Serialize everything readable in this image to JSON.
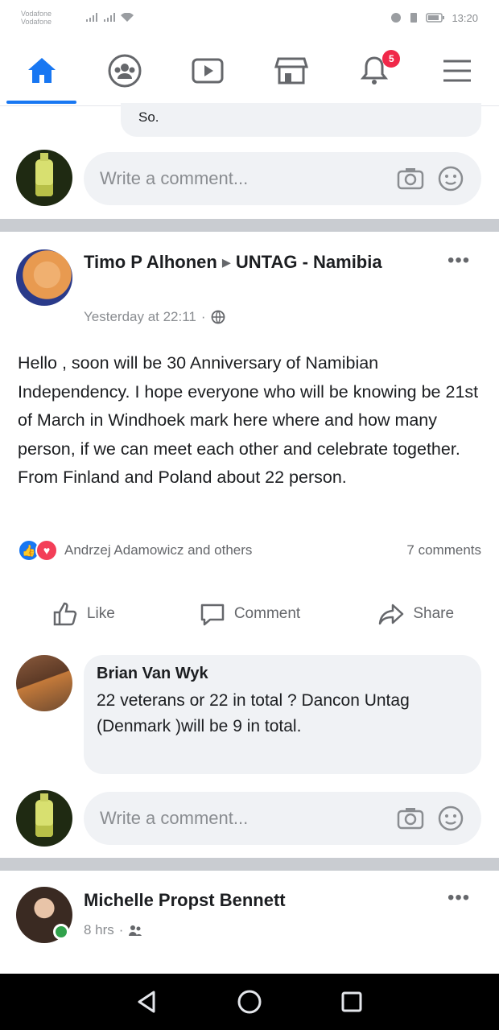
{
  "status_bar": {
    "carrier_line1": "Vodafone",
    "carrier_line2": "Vodafone",
    "time": "13:20"
  },
  "nav": {
    "tabs": [
      {
        "name": "home",
        "icon": "home-icon",
        "active": true
      },
      {
        "name": "groups",
        "icon": "groups-icon",
        "active": false
      },
      {
        "name": "watch",
        "icon": "watch-icon",
        "active": false
      },
      {
        "name": "marketplace",
        "icon": "marketplace-icon",
        "active": false
      },
      {
        "name": "notifications",
        "icon": "bell-icon",
        "active": false,
        "badge": "5"
      },
      {
        "name": "menu",
        "icon": "menu-icon",
        "active": false
      }
    ],
    "accent_color": "#1877f2"
  },
  "partial_comment": {
    "text": "So."
  },
  "top_comment_box": {
    "placeholder": "Write a comment..."
  },
  "post": {
    "author": "Timo P Alhonen",
    "group": "UNTAG - Namibia",
    "timestamp": "Yesterday at 22:11",
    "body": "Hello , soon will be 30 Anniversary of Namibian Independency. I hope everyone who will be knowing be 21st of March in Windhoek mark here where and how many person, if we can meet each other and celebrate together. From Finland and Poland about 22 person.",
    "reactions_text": "Andrzej Adamowicz and others",
    "comments_count": "7 comments",
    "actions": {
      "like": "Like",
      "comment": "Comment",
      "share": "Share"
    }
  },
  "comment": {
    "author": "Brian Van Wyk",
    "text": "22 veterans or 22 in total ? Dancon Untag (Denmark )will be 9 in total."
  },
  "bottom_comment_box": {
    "placeholder": "Write a comment..."
  },
  "next_post": {
    "author": "Michelle Propst Bennett",
    "timestamp": "8 hrs"
  }
}
